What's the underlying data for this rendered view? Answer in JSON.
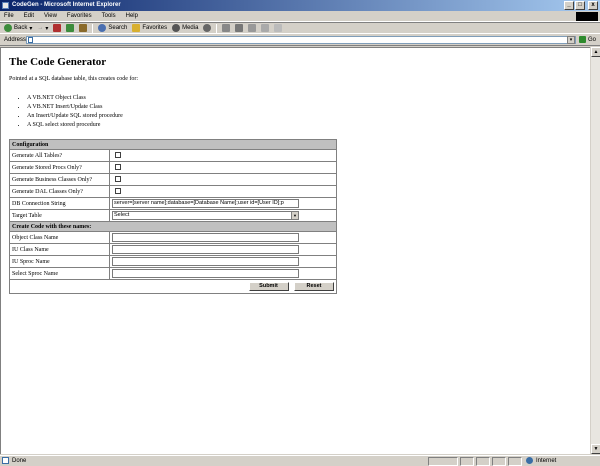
{
  "window": {
    "title": "CodeGen - Microsoft Internet Explorer",
    "min": "_",
    "max": "□",
    "close": "x"
  },
  "menu": [
    "File",
    "Edit",
    "View",
    "Favorites",
    "Tools",
    "Help"
  ],
  "toolbar": {
    "back": "Back",
    "search": "Search",
    "favorites": "Favorites",
    "media": "Media"
  },
  "address": {
    "label": "Address",
    "value": "",
    "go": "Go"
  },
  "page": {
    "title": "The Code Generator",
    "intro": "Pointed at a SQL database table, this creates code for:",
    "bullets": [
      "A VB.NET Object Class",
      "A VB.NET Insert/Update Class",
      "An Insert/Update SQL stored procedure",
      "A SQL select stored procedure"
    ]
  },
  "config": {
    "header": "Configuration",
    "gen_all": "Generate All Tables?",
    "gen_procs": "Generate Stored Procs Only?",
    "gen_business": "Generate Business Classes Only?",
    "gen_dal": "Generate DAL Classes Only?",
    "db_conn_label": "DB Connection String",
    "db_conn_value": "server=[server name];database=[Database Name];user id=[User ID];p",
    "target_label": "Target Table",
    "target_value": "Select",
    "names_header": "Create Code with these names:",
    "object_class": "Object Class Name",
    "iu_class": "IU Class Name",
    "iu_sproc": "IU Sproc Name",
    "select_sproc": "Select Sproc Name",
    "submit": "Submit",
    "reset": "Reset"
  },
  "status": {
    "left": "Done",
    "zone": "Internet"
  }
}
